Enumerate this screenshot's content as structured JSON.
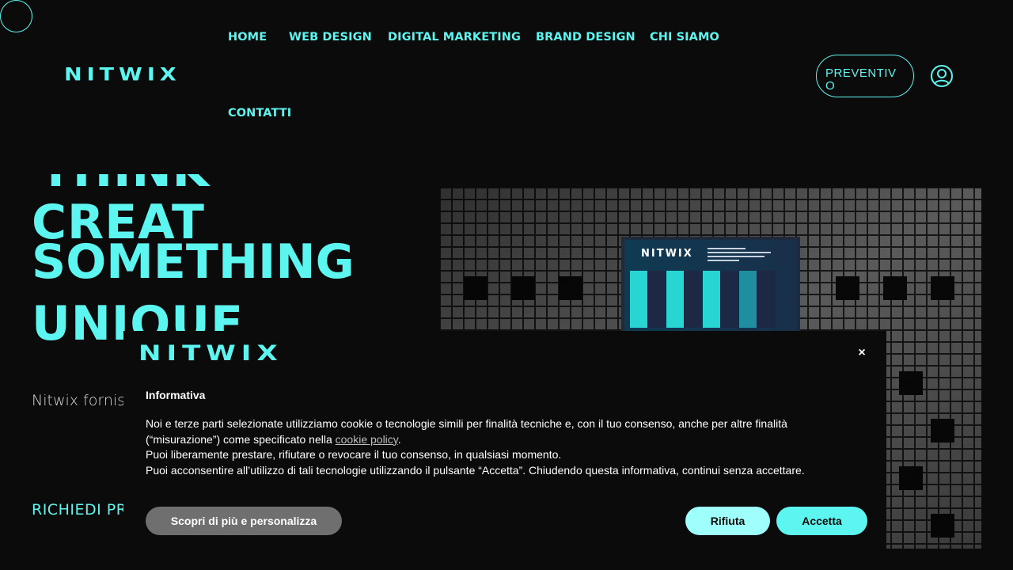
{
  "brand": {
    "logo_text": "NITWIX",
    "accent_color": "#5cf5ef",
    "background": "#0b0b0c"
  },
  "nav": {
    "items": [
      {
        "label": "HOME"
      },
      {
        "label": "WEB DESIGN"
      },
      {
        "label": "DIGITAL MARKETING"
      },
      {
        "label": "BRAND DESIGN"
      },
      {
        "label": "CHI SIAMO"
      },
      {
        "label": "CONTATTI"
      }
    ],
    "quote_button": "PREVENTIVO",
    "account_icon": "user-circle-icon"
  },
  "hero": {
    "line_think": "THINK",
    "line_creat": "CREAT",
    "line_something": "SOMETHING",
    "line_unique": "UNIQUE",
    "description": "Nitwix fornisc business per dalla concorr",
    "cta": "RICHIEDI PR"
  },
  "hero_image": {
    "product_label": "NITWIX"
  },
  "cookie_banner": {
    "logo_text": "NITWIX",
    "close_label": "×",
    "title": "Informativa",
    "text_line1_before_link": "Noi e terze parti selezionate utilizziamo cookie o tecnologie simili per finalità tecniche e, con il tuo consenso, anche per altre finalità (“misurazione”) come specificato nella ",
    "link_label": "cookie policy",
    "text_line1_after_link": ".",
    "text_line2": "Puoi liberamente prestare, rifiutare o revocare il tuo consenso, in qualsiasi momento.",
    "text_line3": "Puoi acconsentire all’utilizzo di tali tecnologie utilizzando il pulsante “Accetta”. Chiudendo questa informativa, continui senza accettare.",
    "customize_button": "Scopri di più e personalizza",
    "reject_button": "Rifiuta",
    "accept_button": "Accetta"
  }
}
